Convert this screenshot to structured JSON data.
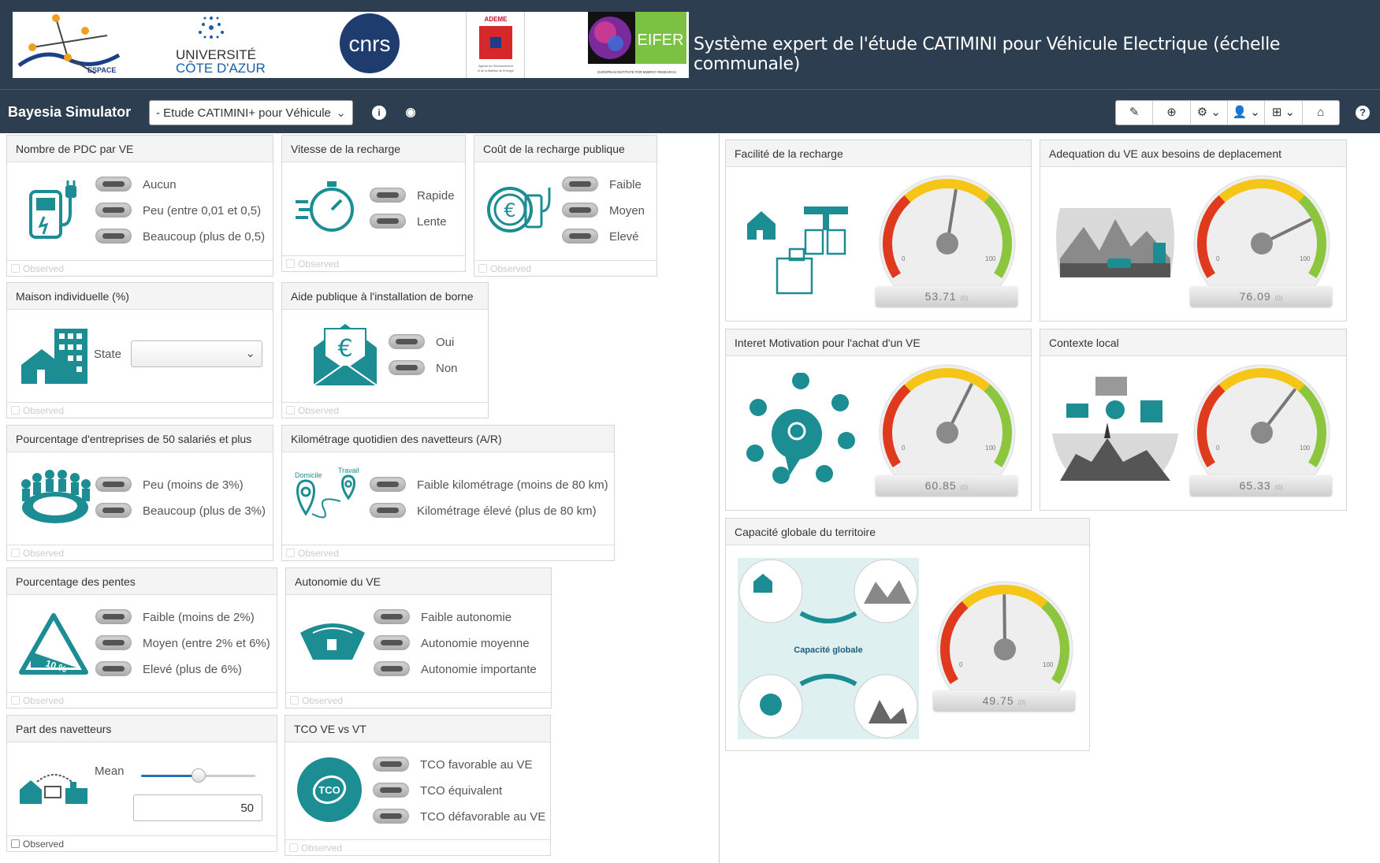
{
  "banner": {
    "title": "Système expert de l'étude CATIMINI pour Véhicule Electrique (échelle communale)",
    "logos": {
      "espace": "ESPACE",
      "uca_line1": "UNIVERSITÉ",
      "uca_line2": "CÔTE D'AZUR",
      "cnrs": "cnrs",
      "ademe": "ADEME",
      "ademe_sub1": "Agence de l'Environnement",
      "ademe_sub2": "et de la Maîtrise de l'Energie",
      "eifer": "EIFER",
      "eifer_sub": "EUROPEAN INSTITUTE FOR ENERGY RESEARCH"
    }
  },
  "toolbar": {
    "app_name": "Bayesia Simulator",
    "network_select": "- Etude CATIMINI+ pour Véhicule",
    "info_glyph": "i",
    "eye_glyph": "◉",
    "tools": [
      "✎",
      "⊕",
      "⚙ ⌄",
      "👤 ⌄",
      "⊞ ⌄",
      "⌂"
    ],
    "help_glyph": "?"
  },
  "colors": {
    "teal": "#1c8d93",
    "header": "#2c3e50",
    "gauge_red": "#e03a1e",
    "gauge_yellow": "#f5c518",
    "gauge_green": "#8cc63f"
  },
  "observed_label": "Observed",
  "panels": {
    "pdc": {
      "title": "Nombre de PDC par VE",
      "options": [
        "Aucun",
        "Peu (entre 0,01 et 0,5)",
        "Beaucoup (plus de 0,5)"
      ]
    },
    "vitesse": {
      "title": "Vitesse de la recharge",
      "options": [
        "Rapide",
        "Lente"
      ]
    },
    "cout": {
      "title": "Coût de la recharge publique",
      "options": [
        "Faible",
        "Moyen",
        "Elevé"
      ]
    },
    "maison": {
      "title": "Maison individuelle (%)",
      "state_label": "State",
      "state_value": ""
    },
    "aide": {
      "title": "Aide publique à l'installation de borne",
      "options": [
        "Oui",
        "Non"
      ]
    },
    "entreprises": {
      "title": "Pourcentage d'entreprises de 50 salariés et plus",
      "options": [
        "Peu (moins de 3%)",
        "Beaucoup (plus de 3%)"
      ]
    },
    "kilometrage": {
      "title": "Kilométrage quotidien des navetteurs (A/R)",
      "options": [
        "Faible kilométrage (moins de 80 km)",
        "Kilométrage élevé (plus de 80 km)"
      ],
      "icon_labels": {
        "home": "Domicile",
        "work": "Travail"
      }
    },
    "pentes": {
      "title": "Pourcentage des pentes",
      "options": [
        "Faible (moins de 2%)",
        "Moyen (entre 2% et 6%)",
        "Elevé (plus de 6%)"
      ],
      "icon_text": "10 %"
    },
    "autonomie": {
      "title": "Autonomie du VE",
      "options": [
        "Faible autonomie",
        "Autonomie moyenne",
        "Autonomie importante"
      ]
    },
    "navetteurs": {
      "title": "Part des navetteurs",
      "mean_label": "Mean",
      "value": "50",
      "slider_fraction": 0.5
    },
    "tco": {
      "title": "TCO VE vs VT",
      "options": [
        "TCO favorable au VE",
        "TCO équivalent",
        "TCO défavorable au VE"
      ],
      "icon_text": "TCO"
    }
  },
  "gauges": {
    "facilite": {
      "title": "Facilité de la recharge",
      "value": "53.71",
      "suffix": "(0)",
      "min": "0",
      "max": "100"
    },
    "adequation": {
      "title": "Adequation du VE aux besoins de deplacement",
      "value": "76.09",
      "suffix": "(0)",
      "min": "0",
      "max": "100"
    },
    "interet": {
      "title": "Interet Motivation pour l'achat d'un VE",
      "value": "60.85",
      "suffix": "(0)",
      "min": "0",
      "max": "100"
    },
    "contexte": {
      "title": "Contexte local",
      "value": "65.33",
      "suffix": "(0)",
      "min": "0",
      "max": "100"
    },
    "capacite": {
      "title": "Capacité globale du territoire",
      "value": "49.75",
      "suffix": "(0)",
      "min": "0",
      "max": "100",
      "diagram_label": "Capacité globale"
    }
  }
}
